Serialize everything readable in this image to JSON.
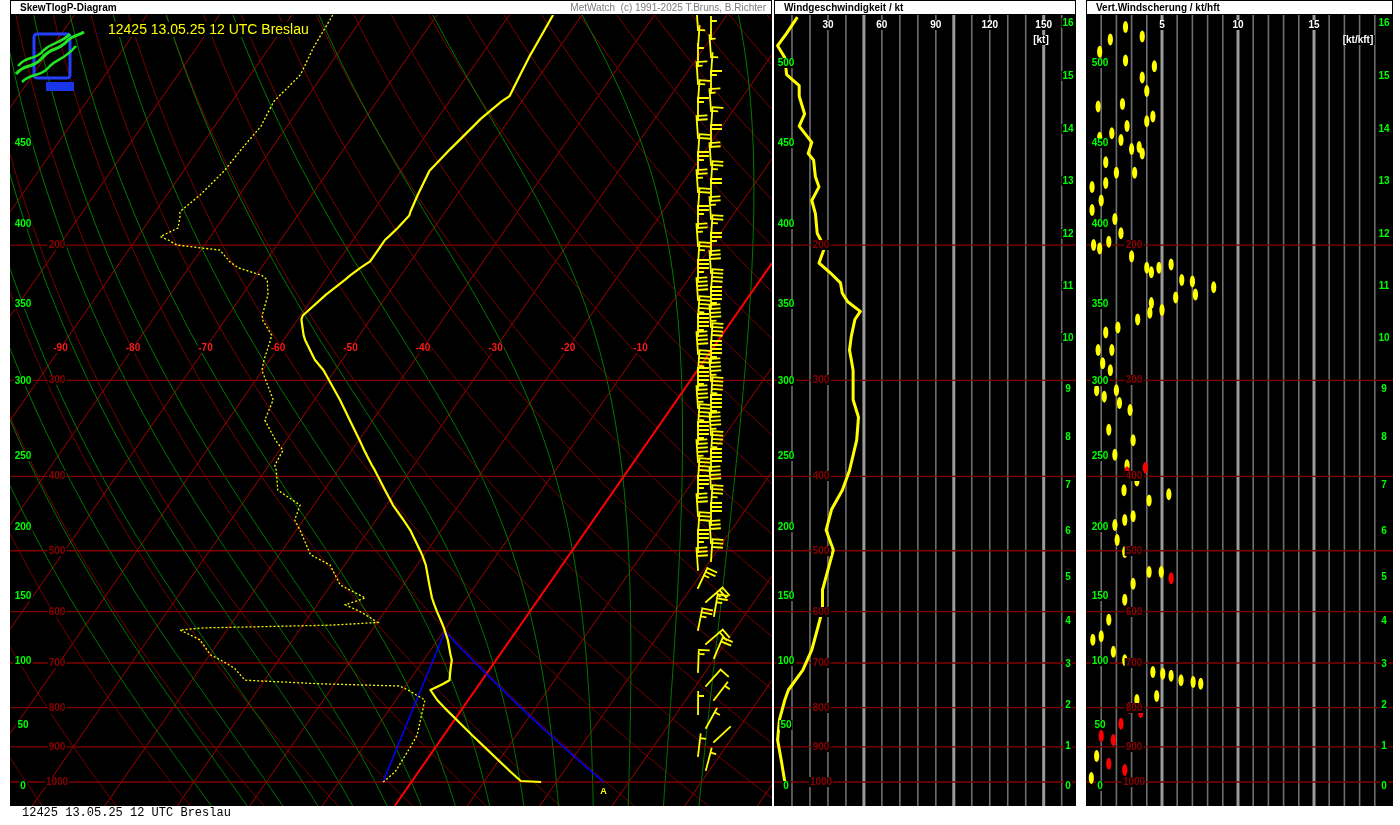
{
  "skewt_panel": {
    "title": "SkewTlogP-Diagram",
    "credit": "MetWatch  (c) 1991-2025 T.Bruns, B.Richter",
    "station_heading": "12425 13.05.25 12 UTC Breslau",
    "flight_level_labels": [
      "450",
      "400",
      "350",
      "300",
      "250",
      "200",
      "150",
      "100",
      "50",
      "0"
    ],
    "pressure_labels": [
      "200",
      "300",
      "400",
      "500",
      "600",
      "700",
      "800",
      "900",
      "1000"
    ],
    "temperature_labels": [
      "-90",
      "-80",
      "-70",
      "-60",
      "-50",
      "-40",
      "-30",
      "-20",
      "-10"
    ],
    "parcel_label": "A"
  },
  "wind_speed_panel": {
    "title": "Windgeschwindigkeit / kt",
    "speed_tick_labels": [
      "30",
      "60",
      "90",
      "120",
      "150"
    ],
    "unit": "[kt]",
    "flight_level_labels": [
      "500",
      "450",
      "400",
      "350",
      "300",
      "250",
      "200",
      "150",
      "100",
      "50",
      "0"
    ],
    "pressure_labels": [
      "200",
      "300",
      "400",
      "500",
      "600",
      "700",
      "800",
      "900",
      "1000"
    ],
    "height_labels": [
      "16",
      "15",
      "14",
      "13",
      "12",
      "11",
      "10",
      "9",
      "8",
      "7",
      "6",
      "5",
      "4",
      "3",
      "2",
      "1",
      "0"
    ]
  },
  "wind_shear_panel": {
    "title": "Vert.Windscherung / kt/hft",
    "shear_tick_labels": [
      "5",
      "10",
      "15"
    ],
    "unit": "[kt/kft]",
    "flight_level_labels": [
      "500",
      "450",
      "400",
      "350",
      "300",
      "250",
      "200",
      "150",
      "100",
      "50",
      "0"
    ],
    "pressure_labels": [
      "200",
      "300",
      "400",
      "500",
      "600",
      "700",
      "800",
      "900",
      "1000"
    ],
    "height_labels": [
      "16",
      "15",
      "14",
      "13",
      "12",
      "11",
      "10",
      "9",
      "8",
      "7",
      "6",
      "5",
      "4",
      "3",
      "2",
      "1",
      "0"
    ]
  },
  "footer": "12425 13.05.25 12 UTC Breslau"
}
